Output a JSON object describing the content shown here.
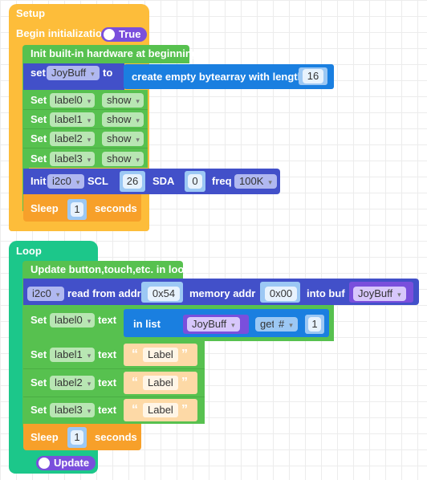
{
  "setup": {
    "title": "Setup",
    "begin_label": "Begin initialization",
    "begin_toggle": "True",
    "init_hw_label": "Init built-in hardware at beginning",
    "set_block": {
      "keyword": "set",
      "variable": "JoyBuff",
      "to": "to",
      "value_label": "create empty bytearray with length",
      "length": "16"
    },
    "label_rows": [
      {
        "keyword": "Set",
        "label": "label0",
        "state": "show"
      },
      {
        "keyword": "Set",
        "label": "label1",
        "state": "show"
      },
      {
        "keyword": "Set",
        "label": "label2",
        "state": "show"
      },
      {
        "keyword": "Set",
        "label": "label3",
        "state": "show"
      }
    ],
    "i2c_init": {
      "keyword": "Init",
      "bus": "i2c0",
      "scl_label": "SCL",
      "scl": "26",
      "sda_label": "SDA",
      "sda": "0",
      "freq_label": "freq",
      "freq": "100K"
    },
    "sleep": {
      "keyword": "Sleep",
      "value": "1",
      "unit": "seconds"
    }
  },
  "loop": {
    "title": "Loop",
    "update_label": "Update button,touch,etc. in loop",
    "i2c_read": {
      "bus": "i2c0",
      "read_label": "read from addr",
      "addr": "0x54",
      "mem_label": "memory addr",
      "mem": "0x00",
      "buf_label": "into buf",
      "buf": "JoyBuff"
    },
    "text_rows": [
      {
        "keyword": "Set",
        "label": "label0",
        "text_kw": "text",
        "list_label": "in list",
        "list_var": "JoyBuff",
        "op": "get",
        "index_mode": "#",
        "index": "1"
      },
      {
        "keyword": "Set",
        "label": "label1",
        "text_kw": "text",
        "string": "Label"
      },
      {
        "keyword": "Set",
        "label": "label2",
        "text_kw": "text",
        "string": "Label"
      },
      {
        "keyword": "Set",
        "label": "label3",
        "text_kw": "text",
        "string": "Label"
      }
    ],
    "sleep": {
      "keyword": "Sleep",
      "value": "1",
      "unit": "seconds"
    },
    "update_toggle": "Update"
  },
  "dropdown_arrow": "▾",
  "open_quote": "“",
  "close_quote": "”"
}
